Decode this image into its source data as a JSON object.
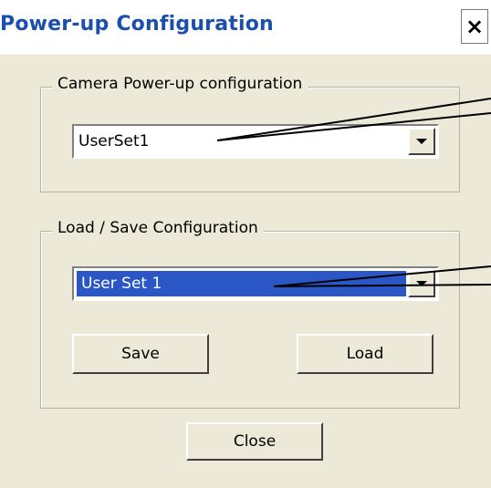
{
  "window": {
    "title": "Power-up Configuration",
    "close_glyph": "×"
  },
  "power_up_group": {
    "label": "Camera Power-up configuration",
    "select_value": "UserSet1"
  },
  "load_save_group": {
    "label": "Load / Save Configuration",
    "select_value": "User Set 1",
    "save_label": "Save",
    "load_label": "Load"
  },
  "footer": {
    "close_label": "Close"
  },
  "colors": {
    "title_text": "#1b4fae",
    "dialog_bg": "#ece9d8",
    "selection": "#2a56c6"
  },
  "icons": {
    "close": "close-icon",
    "dropdown": "chevron-down-icon"
  }
}
